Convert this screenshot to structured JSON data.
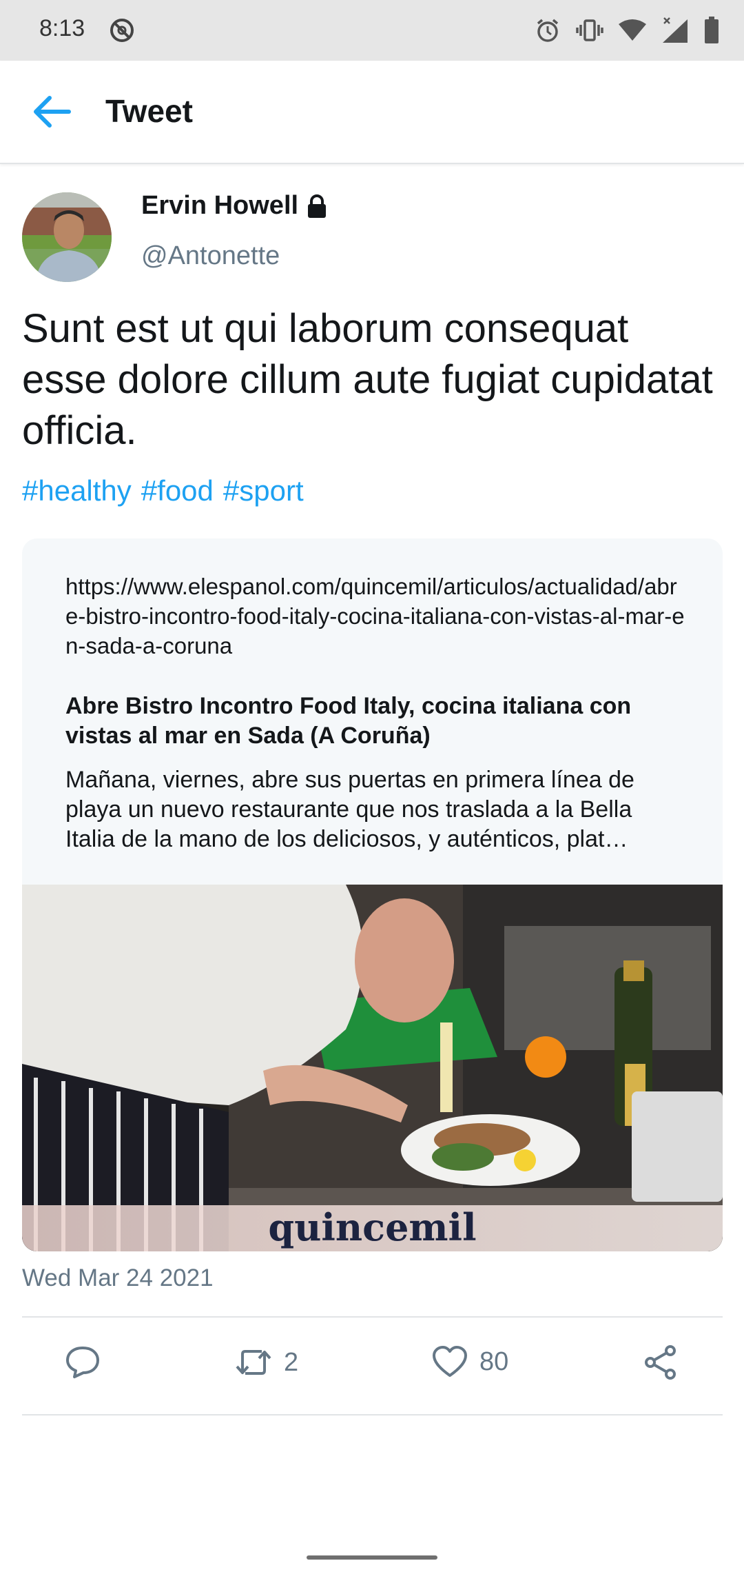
{
  "status_bar": {
    "time": "8:13"
  },
  "app_bar": {
    "title": "Tweet"
  },
  "tweet": {
    "author_name": "Ervin Howell",
    "handle": "@Antonette",
    "text": "Sunt est ut qui laborum consequat esse dolore cillum aute fugiat cupidatat officia.",
    "hashtags": [
      "#healthy",
      "#food",
      "#sport"
    ],
    "link_card": {
      "url": "https://www.elespanol.com/quincemil/articulos/actualidad/abre-bistro-incontro-food-italy-cocina-italiana-con-vistas-al-mar-en-sada-a-coruna",
      "title": "Abre Bistro Incontro Food Italy, cocina italiana con vistas al mar en Sada (A Coruña)",
      "description": "Mañana, viernes, abre sus puertas en primera línea de playa un nuevo restaurante que nos traslada a la Bella Italia de la mano de los deliciosos, y auténticos, plat…",
      "image_watermark": "quincemil"
    },
    "date": "Wed Mar 24 2021",
    "retweet_count": "2",
    "like_count": "80"
  },
  "colors": {
    "accent": "#1da1f2",
    "secondary_text": "#657786",
    "card_bg": "#f5f8fa"
  }
}
